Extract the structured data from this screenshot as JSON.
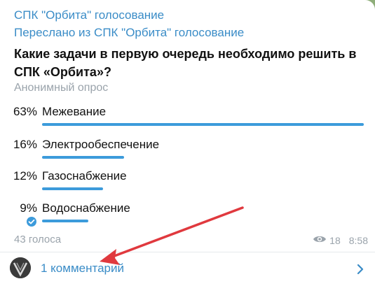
{
  "message": {
    "channel_title": "СПК \"Орбита\" голосование",
    "forwarded_from": "Переслано из СПК \"Орбита\" голосование",
    "question": "Какие задачи в первую очередь необходимо решить в СПК «Орбита»?",
    "poll_type": "Анонимный опрос",
    "options": [
      {
        "percent": "63%",
        "label": "Межевание",
        "share": 0.63
      },
      {
        "percent": "16%",
        "label": "Электрообеспечение",
        "share": 0.16
      },
      {
        "percent": "12%",
        "label": "Газоснабжение",
        "share": 0.12
      },
      {
        "percent": "9%",
        "label": "Водоснабжение",
        "share": 0.09
      }
    ],
    "votes": "43 голоса",
    "views": "18",
    "time": "8:58",
    "comments_label": "1 комментарий"
  },
  "colors": {
    "link": "#3a8cc7",
    "bar": "#3c9bdb",
    "arrow": "#e0393e"
  },
  "icons": {
    "views": "eye-icon",
    "selected": "check-circle-icon",
    "open_comments": "chevron-right-icon"
  }
}
